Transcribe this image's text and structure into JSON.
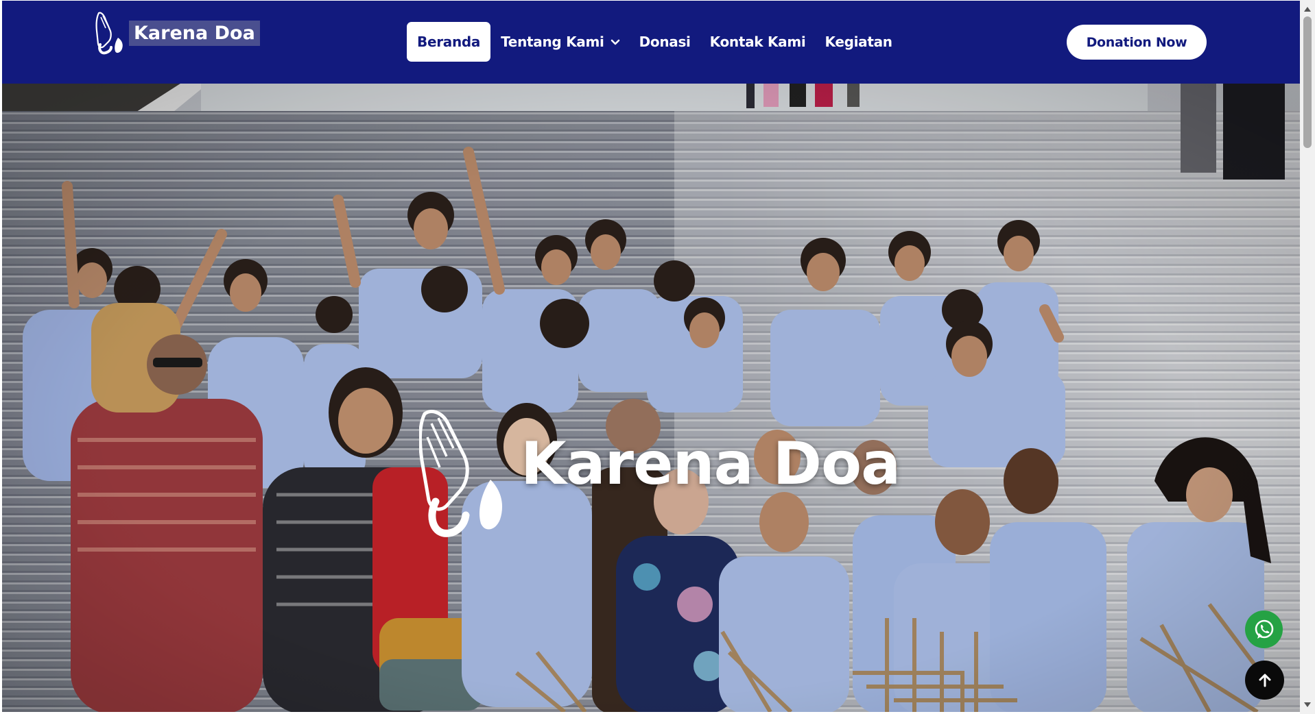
{
  "brand": {
    "name": "Karena Doa",
    "icon": "praying-hands-icon"
  },
  "nav": {
    "items": [
      {
        "label": "Beranda",
        "active": true
      },
      {
        "label": "Tentang Kami",
        "has_dropdown": true
      },
      {
        "label": "Donasi"
      },
      {
        "label": "Kontak Kami"
      },
      {
        "label": "Kegiatan"
      }
    ]
  },
  "cta": {
    "donate_label": "Donation Now"
  },
  "hero": {
    "title": "Karena Doa",
    "icon": "praying-hands-icon",
    "background": "group-photo-of-students-on-stairs"
  },
  "floating": {
    "whatsapp_icon": "whatsapp-icon",
    "back_to_top_icon": "arrow-up-icon"
  },
  "colors": {
    "navbar": "#121a7e",
    "button_bg": "#ffffff",
    "whatsapp": "#25a244",
    "back_to_top": "#0a0a0a"
  }
}
